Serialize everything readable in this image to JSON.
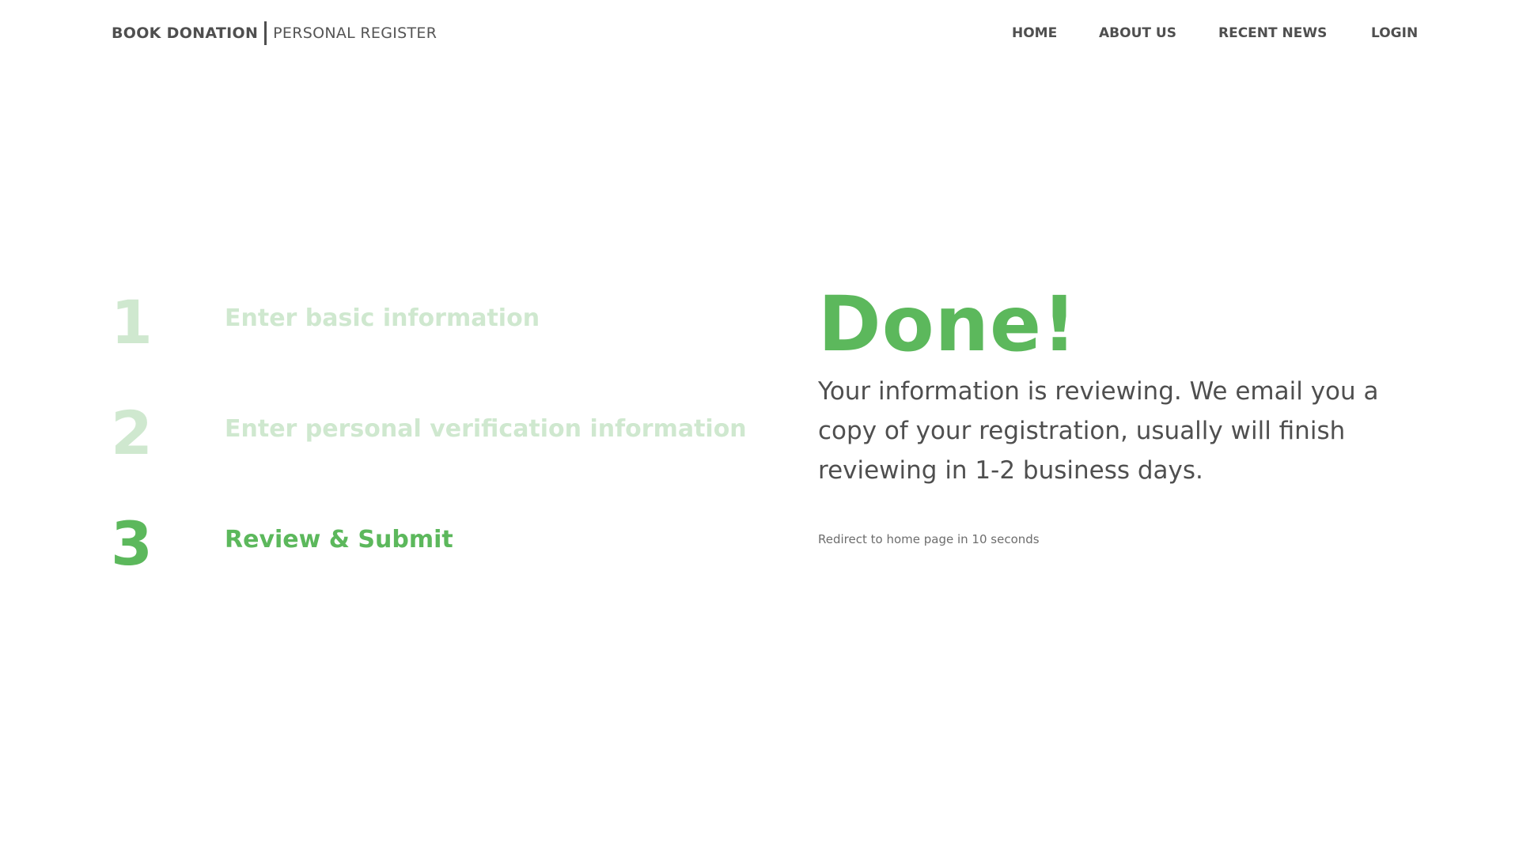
{
  "header": {
    "brand": "BOOK DONATION",
    "subtitle": "PERSONAL REGISTER",
    "nav": {
      "home": "HOME",
      "about": "ABOUT US",
      "news": "RECENT NEWS",
      "login": "LOGIN"
    }
  },
  "steps": [
    {
      "number": "1",
      "label": "Enter basic information",
      "state": "completed"
    },
    {
      "number": "2",
      "label": "Enter personal verification information",
      "state": "completed"
    },
    {
      "number": "3",
      "label": "Review & Submit",
      "state": "active"
    }
  ],
  "done": {
    "title": "Done!",
    "message": "Your information is reviewing. We email you a copy of your registration, usually will finish reviewing in 1-2 business days.",
    "redirect": "Redirect to home page in 10 seconds"
  },
  "colors": {
    "accent": "#5cb85c",
    "accent_faded": "#cfe8cf",
    "text": "#4f4f4f"
  }
}
